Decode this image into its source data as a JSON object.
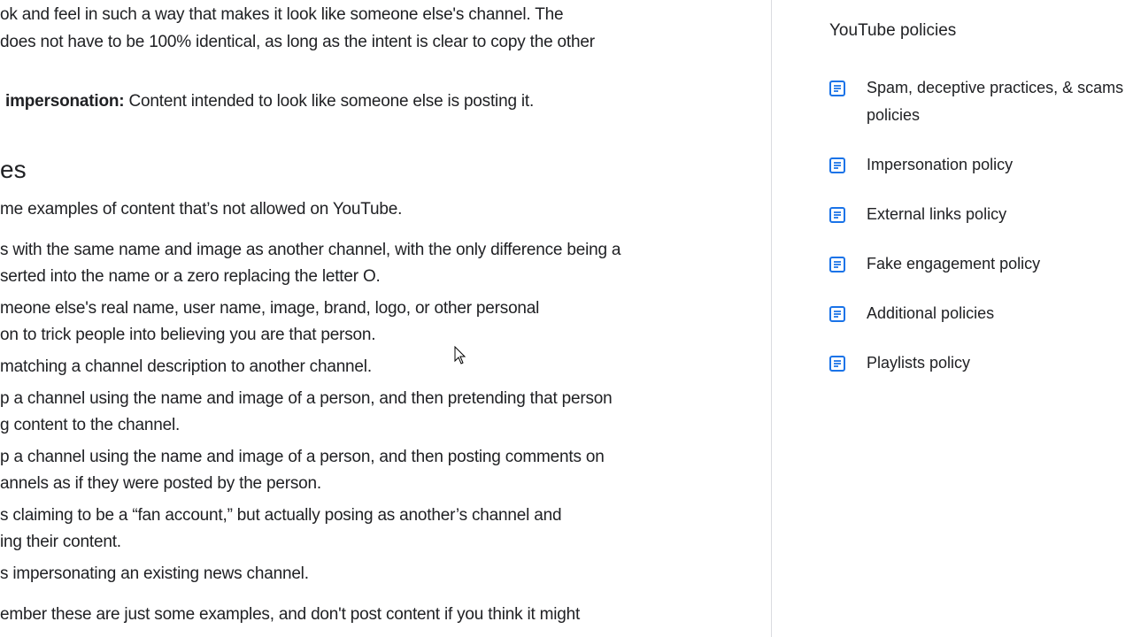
{
  "main": {
    "lines": [
      "ok and feel in such a way that makes it look like someone else's channel. The",
      "does not have to be 100% identical, as long as the intent is clear to copy the other"
    ],
    "impersonation_bold": "impersonation:",
    "impersonation_text": " Content intended to look like someone else is posting it.",
    "heading": "es",
    "intro": "me examples of content that’s not allowed on YouTube.",
    "examples": [
      "s with the same name and image as another channel, with the only difference being a",
      "serted into the name or a zero replacing the letter O.",
      "meone else's real name, user name, image, brand, logo, or other personal",
      "on to trick people into believing you are that person.",
      "matching a channel description to another channel.",
      "p a channel using the name and image of a person, and then pretending that person",
      "g content to the channel.",
      "p a channel using the name and image of a person, and then posting comments on",
      "annels as if they were posted by the person.",
      "s claiming to be a “fan account,” but actually posing as another’s channel and",
      "ing their content.",
      "s impersonating an existing news channel."
    ],
    "remember": "ember these are just some examples, and don't post content if you think it might"
  },
  "sidebar": {
    "title": "YouTube policies",
    "items": [
      {
        "label": "Spam, deceptive practices, & scams policies"
      },
      {
        "label": "Impersonation policy"
      },
      {
        "label": "External links policy"
      },
      {
        "label": "Fake engagement policy"
      },
      {
        "label": "Additional policies"
      },
      {
        "label": "Playlists policy"
      }
    ],
    "icon": "document-icon",
    "icon_color": "#1a73e8"
  }
}
